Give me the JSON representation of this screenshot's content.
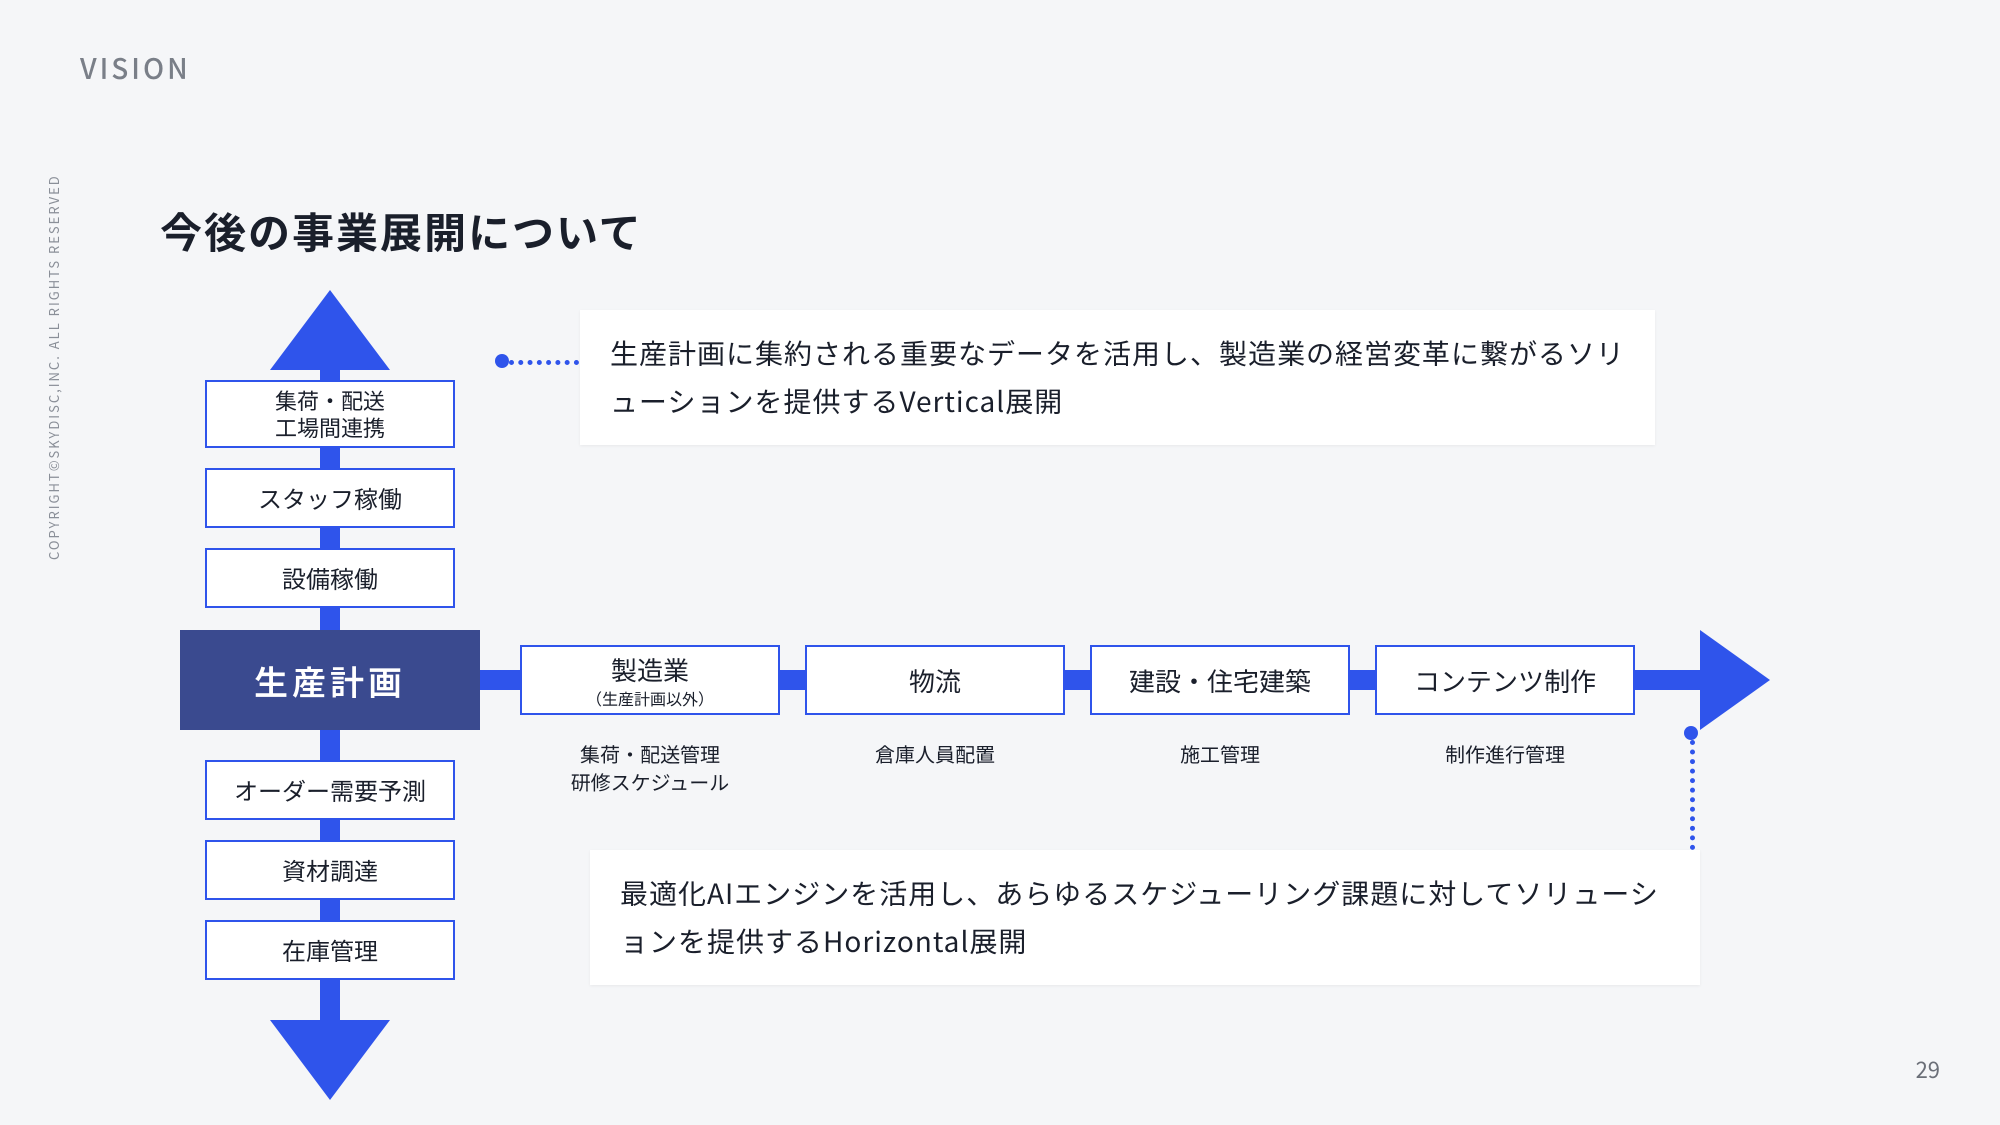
{
  "meta": {
    "section_label": "VISION",
    "copyright": "COPYRIGHT©SKYDISC,INC. ALL RIGHTS RESERVED",
    "page_number": "29"
  },
  "title": "今後の事業展開について",
  "core": "生産計画",
  "vertical_up": [
    "集荷・配送\n工場間連携",
    "スタッフ稼働",
    "設備稼働"
  ],
  "vertical_down": [
    "オーダー需要予測",
    "資材調達",
    "在庫管理"
  ],
  "horizontal": [
    {
      "label": "製造業",
      "sub": "（生産計画以外）",
      "caption": "集荷・配送管理\n研修スケジュール"
    },
    {
      "label": "物流",
      "sub": "",
      "caption": "倉庫人員配置"
    },
    {
      "label": "建設・住宅建築",
      "sub": "",
      "caption": "施工管理"
    },
    {
      "label": "コンテンツ制作",
      "sub": "",
      "caption": "制作進行管理"
    }
  ],
  "cards": {
    "vertical_expansion": "生産計画に集約される重要なデータを活用し、製造業の経営変革に繋がるソリューションを提供するVertical展開",
    "horizontal_expansion": "最適化AIエンジンを活用し、あらゆるスケジューリング課題に対してソリューションを提供するHorizontal展開"
  }
}
